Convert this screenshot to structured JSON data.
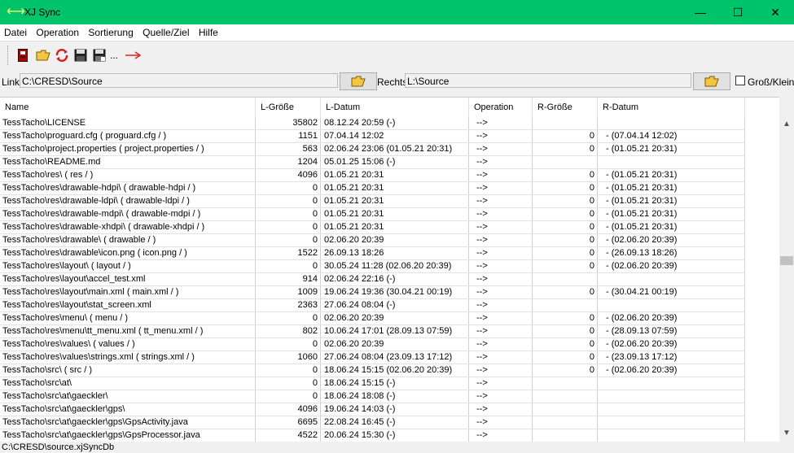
{
  "window": {
    "title": "XJ Sync",
    "controls": {
      "minimize": "—",
      "maximize": "☐",
      "close": "✕"
    }
  },
  "menu": [
    "Datei",
    "Operation",
    "Sortierung",
    "Quelle/Ziel",
    "Hilfe"
  ],
  "toolbar": {
    "icons": [
      "device-icon",
      "open-folder-icon",
      "refresh-icon",
      "save-icon",
      "save-as-icon",
      "more-icon",
      "execute-arrow-icon"
    ],
    "more_label": "..."
  },
  "paths": {
    "left_label": "Links",
    "left_value": "C:\\CRESD\\Source",
    "right_label": "Rechts",
    "right_value": "L:\\Source",
    "case_label": "Groß/Klein",
    "case_checked": false
  },
  "table": {
    "columns": [
      "Name",
      "L-Größe",
      "L-Datum",
      "Operation",
      "R-Größe",
      "R-Datum"
    ],
    "rows": [
      [
        "TessTacho\\LICENSE",
        "35802",
        "08.12.24 20:59 (-)",
        "-->",
        "",
        ""
      ],
      [
        "TessTacho\\proguard.cfg ( proguard.cfg / )",
        "1151",
        "07.04.14 12:02",
        "-->",
        "0",
        " - (07.04.14 12:02)"
      ],
      [
        "TessTacho\\project.properties ( project.properties / )",
        "563",
        "02.06.24 23:06 (01.05.21 20:31)",
        "-->",
        "0",
        " - (01.05.21 20:31)"
      ],
      [
        "TessTacho\\README.md",
        "1204",
        "05.01.25 15:06 (-)",
        "-->",
        "",
        ""
      ],
      [
        "TessTacho\\res\\ ( res / )",
        "4096",
        "01.05.21 20:31",
        "-->",
        "0",
        " - (01.05.21 20:31)"
      ],
      [
        "TessTacho\\res\\drawable-hdpi\\ ( drawable-hdpi / )",
        "0",
        "01.05.21 20:31",
        "-->",
        "0",
        " - (01.05.21 20:31)"
      ],
      [
        "TessTacho\\res\\drawable-ldpi\\ ( drawable-ldpi / )",
        "0",
        "01.05.21 20:31",
        "-->",
        "0",
        " - (01.05.21 20:31)"
      ],
      [
        "TessTacho\\res\\drawable-mdpi\\ ( drawable-mdpi / )",
        "0",
        "01.05.21 20:31",
        "-->",
        "0",
        " - (01.05.21 20:31)"
      ],
      [
        "TessTacho\\res\\drawable-xhdpi\\ ( drawable-xhdpi / )",
        "0",
        "01.05.21 20:31",
        "-->",
        "0",
        " - (01.05.21 20:31)"
      ],
      [
        "TessTacho\\res\\drawable\\ ( drawable / )",
        "0",
        "02.06.20 20:39",
        "-->",
        "0",
        " - (02.06.20 20:39)"
      ],
      [
        "TessTacho\\res\\drawable\\icon.png ( icon.png / )",
        "1522",
        "26.09.13 18:26",
        "-->",
        "0",
        " - (26.09.13 18:26)"
      ],
      [
        "TessTacho\\res\\layout\\ ( layout / )",
        "0",
        "30.05.24 11:28 (02.06.20 20:39)",
        "-->",
        "0",
        " - (02.06.20 20:39)"
      ],
      [
        "TessTacho\\res\\layout\\accel_test.xml",
        "914",
        "02.06.24 22:16 (-)",
        "-->",
        "",
        ""
      ],
      [
        "TessTacho\\res\\layout\\main.xml ( main.xml / )",
        "1009",
        "19.06.24 19:36 (30.04.21 00:19)",
        "-->",
        "0",
        " - (30.04.21 00:19)"
      ],
      [
        "TessTacho\\res\\layout\\stat_screen.xml",
        "2363",
        "27.06.24 08:04 (-)",
        "-->",
        "",
        ""
      ],
      [
        "TessTacho\\res\\menu\\ ( menu / )",
        "0",
        "02.06.20 20:39",
        "-->",
        "0",
        " - (02.06.20 20:39)"
      ],
      [
        "TessTacho\\res\\menu\\tt_menu.xml ( tt_menu.xml / )",
        "802",
        "10.06.24 17:01 (28.09.13 07:59)",
        "-->",
        "0",
        " - (28.09.13 07:59)"
      ],
      [
        "TessTacho\\res\\values\\ ( values / )",
        "0",
        "02.06.20 20:39",
        "-->",
        "0",
        " - (02.06.20 20:39)"
      ],
      [
        "TessTacho\\res\\values\\strings.xml ( strings.xml / )",
        "1060",
        "27.06.24 08:04 (23.09.13 17:12)",
        "-->",
        "0",
        " - (23.09.13 17:12)"
      ],
      [
        "TessTacho\\src\\ ( src / )",
        "0",
        "18.06.24 15:15 (02.06.20 20:39)",
        "-->",
        "0",
        " - (02.06.20 20:39)"
      ],
      [
        "TessTacho\\src\\at\\",
        "0",
        "18.06.24 15:15 (-)",
        "-->",
        "",
        ""
      ],
      [
        "TessTacho\\src\\at\\gaeckler\\",
        "0",
        "18.06.24 18:08 (-)",
        "-->",
        "",
        ""
      ],
      [
        "TessTacho\\src\\at\\gaeckler\\gps\\",
        "4096",
        "19.06.24 14:03 (-)",
        "-->",
        "",
        ""
      ],
      [
        "TessTacho\\src\\at\\gaeckler\\gps\\GpsActivity.java",
        "6695",
        "22.08.24 16:45 (-)",
        "-->",
        "",
        ""
      ],
      [
        "TessTacho\\src\\at\\gaeckler\\gps\\GpsProcessor.java",
        "4522",
        "20.06.24 15:30 (-)",
        "-->",
        "",
        ""
      ]
    ]
  },
  "status": "C:\\CRESD\\source.xjSyncDb"
}
